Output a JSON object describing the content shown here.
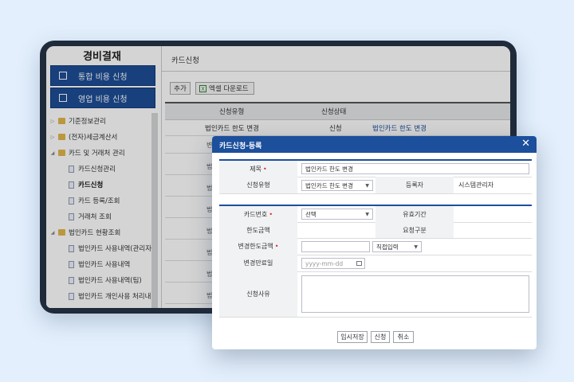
{
  "sidebar": {
    "title": "경비결재",
    "buttons": [
      "통합 비용 신청",
      "영업 비용 신청"
    ],
    "tree": [
      {
        "label": "기준정보관리",
        "type": "folder",
        "expanded": false
      },
      {
        "label": "(전자)세금계산서",
        "type": "folder",
        "expanded": false
      },
      {
        "label": "카드 및 거래처 관리",
        "type": "folder",
        "expanded": true
      },
      {
        "label": "카드신청관리",
        "type": "doc"
      },
      {
        "label": "카드신청",
        "type": "doc",
        "selected": true
      },
      {
        "label": "카드 등록/조회",
        "type": "doc"
      },
      {
        "label": "거래처 조회",
        "type": "doc"
      },
      {
        "label": "법인카드 현황조회",
        "type": "folder",
        "expanded": true
      },
      {
        "label": "법인카드 사용내역(관리자",
        "type": "doc"
      },
      {
        "label": "법인카드 사용내역",
        "type": "doc"
      },
      {
        "label": "법인카드 사용내역(팀)",
        "type": "doc"
      },
      {
        "label": "법인카드 개인사용 처리내",
        "type": "doc"
      },
      {
        "label": "경비신청조회",
        "type": "folder",
        "expanded": true
      },
      {
        "label": "전표조회(관리자)",
        "type": "doc"
      }
    ]
  },
  "main": {
    "title": "카드신청",
    "toolbar": {
      "add": "추가",
      "excel": "엑셀 다운로드",
      "excel_icon": "X"
    },
    "columns": [
      "신청유형",
      "신청상태"
    ],
    "rows": [
      {
        "type": "법인카드 한도 변경",
        "status": "신청",
        "detail": "법인카드 한도 변경"
      }
    ],
    "stub_rows": [
      "변",
      "법",
      "법",
      "법",
      "법",
      "법",
      "법",
      "법"
    ]
  },
  "modal": {
    "title": "카드신청-등록",
    "close": "✕",
    "subject": {
      "label": "제목",
      "value": "법인카드 한도 변경"
    },
    "request_type": {
      "label": "신청유형",
      "value": "법인카드 한도 변경"
    },
    "registrant": {
      "label": "등록자",
      "value": "시스템관리자"
    },
    "card_no": {
      "label": "카드번호",
      "value": "선택"
    },
    "valid_period": {
      "label": "유효기간",
      "value": ""
    },
    "limit_amount": {
      "label": "한도금액",
      "value": ""
    },
    "request_kind": {
      "label": "요청구분",
      "value": ""
    },
    "new_limit": {
      "label": "변경한도금액",
      "value": "",
      "mode": "직접입력"
    },
    "end_date": {
      "label": "변경만료일",
      "placeholder": "yyyy-mm-dd"
    },
    "reason": {
      "label": "신청사유",
      "value": ""
    },
    "buttons": {
      "temp_save": "임시저장",
      "submit": "신청",
      "cancel": "취소"
    }
  },
  "colors": {
    "primary": "#1c4f9c",
    "sidebar_btn": "#1d4e97",
    "folder": "#e1b64c",
    "required": "#e02424",
    "background": "#e3effc"
  }
}
